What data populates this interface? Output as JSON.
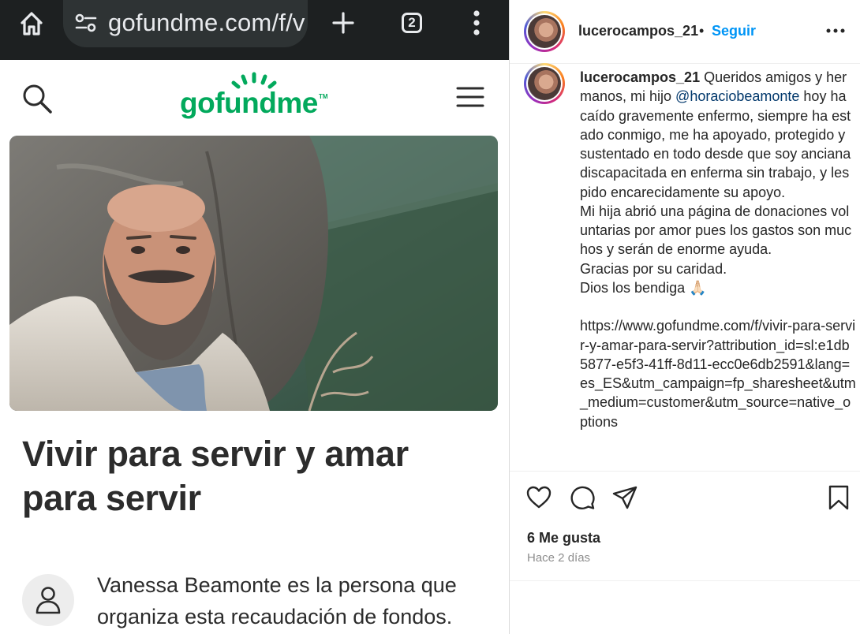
{
  "browser": {
    "url": "gofundme.com/f/vivir-para-servir",
    "tab_count": "2"
  },
  "gofundme": {
    "logo_text": "gofundme",
    "logo_tm": "TM",
    "campaign_title": "Vivir para servir y amar para servir",
    "organizer_text": "Vanessa Beamonte es la persona que organiza esta recaudación de fondos."
  },
  "instagram": {
    "username": "lucerocampos_21",
    "separator": "•",
    "follow_label": "Seguir",
    "caption_user": "lucerocampos_21",
    "caption_part1": " Queridos amigos y hermanos, mi hijo ",
    "mention": "@horaciobeamonte",
    "caption_part2": " hoy ha caído gravemente enfermo, siempre ha estado conmigo, me ha apoyado, protegido y sustentado en todo desde que soy anciana discapacitada en enferma sin trabajo, y les pido encarecidamente su apoyo.\nMi hija abrió una página de donaciones voluntarias por amor pues los gastos son muchos y serán de enorme ayuda.\nGracias por su caridad.\nDios los bendiga 🙏🏻\n\nhttps://www.gofundme.com/f/vivir-para-servir-y-amar-para-servir?attribution_id=sl:e1db5877-e5f3-41ff-8d11-ecc0e6db2591&lang=es_ES&utm_campaign=fp_sharesheet&utm_medium=customer&utm_source=native_options",
    "likes": "6 Me gusta",
    "time_ago": "Hace 2 días"
  },
  "colors": {
    "gofundme_green": "#02a95c",
    "instagram_blue": "#0095f6",
    "browser_dark": "#1d2021"
  },
  "icons": {
    "home": "home-icon",
    "site_settings": "tune-icon",
    "new_tab": "plus-icon",
    "menu": "more-vertical-icon",
    "search": "search-icon",
    "hamburger": "hamburger-menu-icon",
    "user": "user-icon",
    "more": "more-horizontal-icon",
    "like": "heart-icon",
    "comment": "comment-icon",
    "share": "send-icon",
    "save": "bookmark-icon"
  }
}
